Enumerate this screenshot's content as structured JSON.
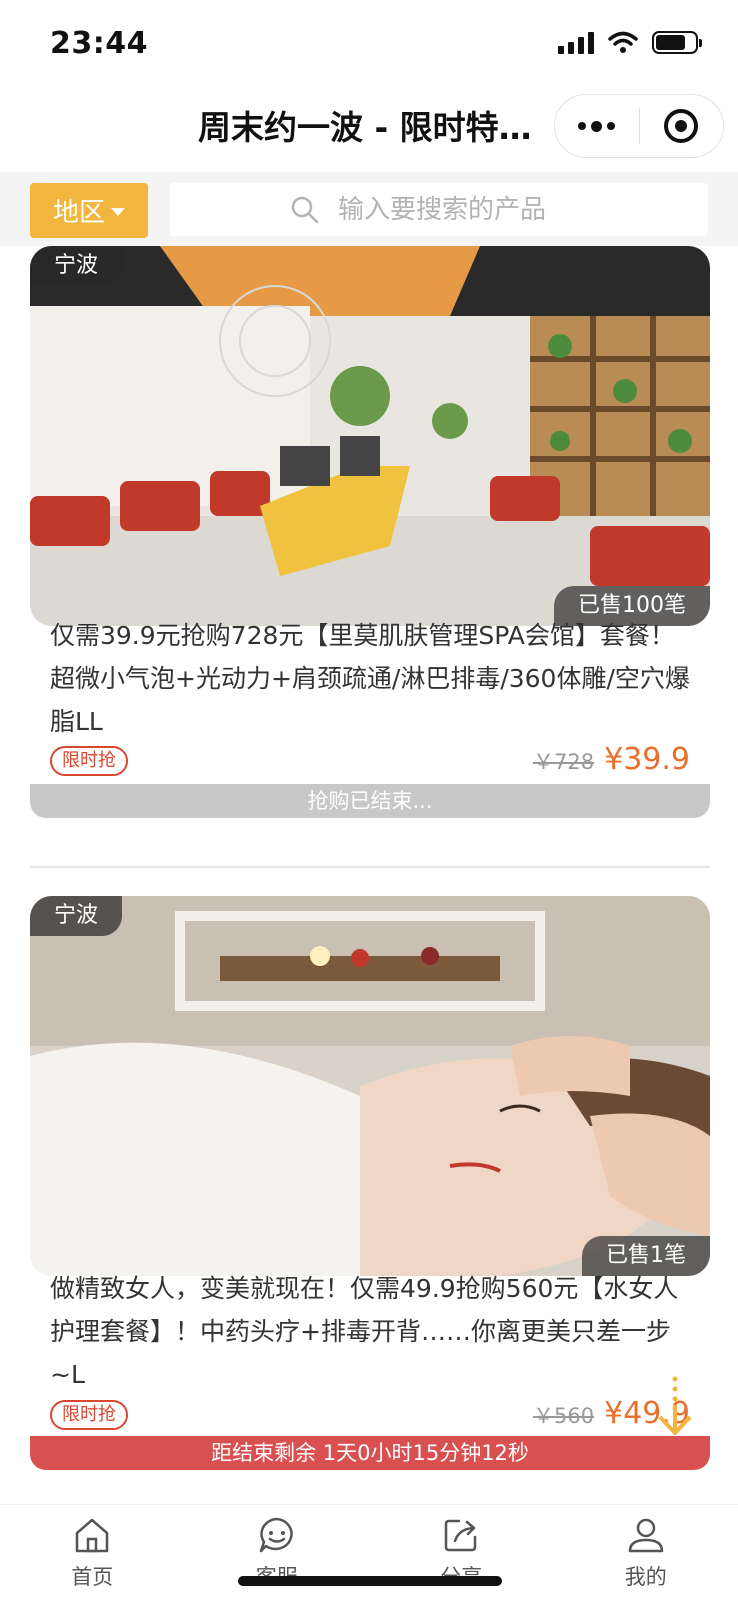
{
  "status_bar": {
    "time": "23:44"
  },
  "nav": {
    "title": "周末约一波 - 限时特…"
  },
  "filter": {
    "region_label": "地区",
    "search_placeholder": "输入要搜索的产品"
  },
  "products": [
    {
      "city": "宁波",
      "sold": "已售100笔",
      "description": "仅需39.9元抢购728元【里莫肌肤管理SPA会馆】套餐！超微小气泡+光动力+肩颈疏通/淋巴排毒/360体雕/空穴爆脂LL",
      "tag": "限时抢",
      "old_price": "￥728",
      "new_price": "¥39.9",
      "bar_text": "抢购已结束..."
    },
    {
      "city": "宁波",
      "sold": "已售1笔",
      "description": "做精致女人，变美就现在！仅需49.9抢购560元【水女人护理套餐】！中药头疗+排毒开背……你离更美只差一步~L",
      "tag": "限时抢",
      "old_price": "￥560",
      "new_price": "¥49.9",
      "bar_text": "距结束剩余 1天0小时15分钟12秒"
    }
  ],
  "tabs": [
    {
      "label": "首页",
      "icon": "home-icon"
    },
    {
      "label": "客服",
      "icon": "chat-icon"
    },
    {
      "label": "分享",
      "icon": "share-icon"
    },
    {
      "label": "我的",
      "icon": "user-icon"
    }
  ],
  "colors": {
    "accent": "#f2b53d",
    "price": "#e8702c",
    "countdown_bar": "#d95050",
    "limited_tag": "#d9472f"
  }
}
